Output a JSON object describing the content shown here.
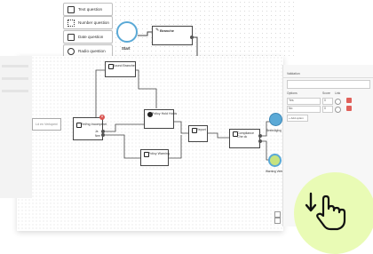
{
  "palette": [
    {
      "label": "Text question",
      "icon": "text-icon"
    },
    {
      "label": "Number question",
      "icon": "number-icon"
    },
    {
      "label": "Date question",
      "icon": "calendar-icon"
    },
    {
      "label": "Radio question",
      "icon": "radio-icon"
    }
  ],
  "top_canvas": {
    "start_label": "Start",
    "branch_label": "Branche"
  },
  "nodes": {
    "sound_branche": "Sound Branche",
    "left_node": "Ld en Verlopen/",
    "reference": "Ref/ng Incompleet",
    "policy_hold": "Policy Hold Holds",
    "policy_warning": "Policy Warning",
    "report": "Report",
    "compliance": "Compliance Che ck",
    "port_ja": "Ja",
    "port_nee": "Nee"
  },
  "end_nodes": {
    "top_label": "Beeindiging",
    "bottom_label": "Warning Verb"
  },
  "sidebar": {
    "title": "Validation",
    "options_label": "Options",
    "col_score": "Score",
    "col_link": "Link",
    "rows": [
      {
        "option": "Yes",
        "score": "0"
      },
      {
        "option": "No",
        "score": "0"
      }
    ],
    "add_option": "+ Add option"
  },
  "colors": {
    "accent_green": "#e9fbb5",
    "node_blue": "#5aa9d6",
    "end_green": "#9ccc65",
    "delete_red": "#e0605a"
  }
}
